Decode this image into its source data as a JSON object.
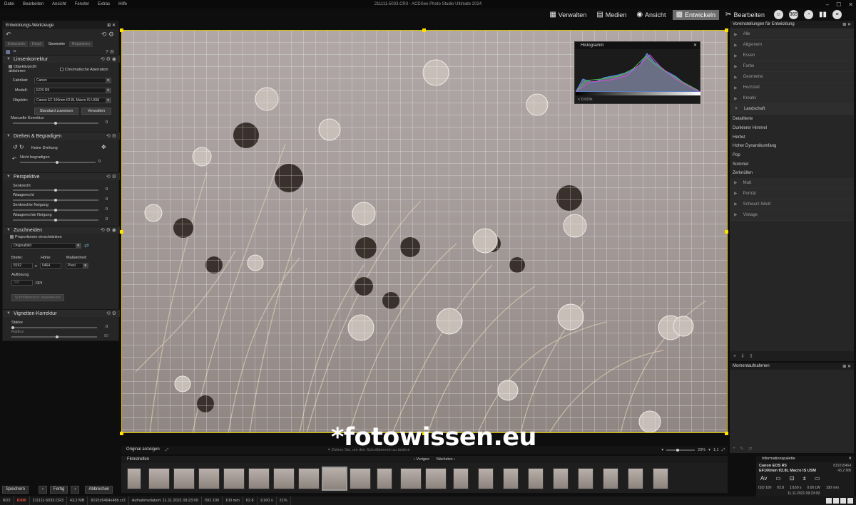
{
  "menubar": {
    "items": [
      "Datei",
      "Bearbeiten",
      "Ansicht",
      "Fenster",
      "Extras",
      "Hilfe"
    ],
    "window_title": "211111-5033.CR3 - ACDSee Photo Studio Ultimate 2024"
  },
  "modes": {
    "verwalten": "Verwalten",
    "medien": "Medien",
    "ansicht": "Ansicht",
    "entwickeln": "Entwickeln",
    "bearbeiten": "Bearbeiten",
    "active": "Entwickeln"
  },
  "left_panel": {
    "title": "Entwicklungs-Werkzeuge",
    "tabs": [
      "Entwickeln",
      "Detail",
      "Geometrie",
      "Reparieren"
    ],
    "active_tab": "Geometrie",
    "lens": {
      "title": "Linsenkorrektur",
      "enable_profile": "Objektivprofil aktivieren",
      "chromatic": "Chromatische Aberration",
      "make_label": "Fabrikat:",
      "make_value": "Canon",
      "model_label": "Modell:",
      "model_value": "EOS R5",
      "lens_label": "Objektiv:",
      "lens_value": "Canon EF 100mm f/2.8L Macro IS USM",
      "default_btn": "Standard zuweisen",
      "manage_btn": "Verwalten",
      "manual_label": "Manuelle Korrektur",
      "manual_value": "0"
    },
    "rotate": {
      "title": "Drehen & Begradigen",
      "rotation": "Keine Drehung",
      "straighten": "Nicht begradigen",
      "straighten_value": "0"
    },
    "perspective": {
      "title": "Perspektive",
      "vertical": "Senkrecht",
      "horizontal": "Waagerecht",
      "vtilt": "Senkrechte Neigung",
      "htilt": "Waagerechte Neigung",
      "v_val": "0",
      "h_val": "0",
      "vt_val": "0",
      "ht_val": "0"
    },
    "crop": {
      "title": "Zuschneiden",
      "constrain": "Proportionen einschränken",
      "ratio": "Originalbild",
      "width_label": "Breite:",
      "height_label": "Höhe:",
      "unit_label": "Maßeinheit:",
      "width": "8192",
      "times": "x",
      "height": "5464",
      "unit": "Pixel",
      "resolution_label": "Auflösung",
      "resolution": "300",
      "dpi": "DPI",
      "maximize_btn": "Schnittbereich maximieren"
    },
    "vignette": {
      "title": "Vignetten-Korrektur",
      "strength": "Stärke",
      "strength_value": "0",
      "radius": "Radius",
      "radius_value": "50"
    }
  },
  "histogram": {
    "title": "Histogramm",
    "stat": "< 0.01%"
  },
  "canvas": {
    "show_original": "Original anzeigen",
    "hint": "Ziehen Sie, um den Schnittbereich zu ändern",
    "zoom": "20%",
    "ratio": "1:1"
  },
  "watermark": "*fotowissen.eu",
  "filmstrip": {
    "title": "Filmstreifen",
    "prev": "Voriges",
    "next": "Nächstes"
  },
  "right_panel": {
    "title": "Voreinstellungen für Entwicklung",
    "categories": [
      "Alle",
      "Allgemein",
      "Essen",
      "Farbe",
      "Geometrie",
      "Hochzeit",
      "Kreativ",
      "Landschaft"
    ],
    "open_category": "Landschaft",
    "presets": [
      "Detaillierte",
      "Dunklerer Himmel",
      "Herbst",
      "Hoher Dynamikumfang",
      "Pop",
      "Sommer",
      "Zerknüllen"
    ],
    "categories_after": [
      "Matt",
      "Porträt",
      "Schwarz-Weiß",
      "Vintage"
    ]
  },
  "snapshots": {
    "title": "Momentaufnahmen"
  },
  "info": {
    "title": "Informationspalette",
    "camera": "Canon EOS R5",
    "lens": "EF100mm f/2.8L Macro IS USM",
    "dims": "8192x5464",
    "size": "43,2 MB",
    "iso": "ISO 100",
    "aperture": "f/2.8",
    "shutter": "1/160 s",
    "ev": "0.00 LW",
    "focal": "100 mm",
    "date": "11.11.2021 09:23:09"
  },
  "bottom_buttons": {
    "save": "Speichern",
    "done": "Fertig",
    "cancel": "Abbrechen"
  },
  "status": {
    "index": "8/22",
    "raw": "RAW",
    "file": "211111-5033.CR3",
    "filesize": "43,2 MB",
    "dims": "8192x5464x48b cr3",
    "date": "Aufnahmedatum: 11.11.2021 09:23:09",
    "iso": "ISO 100",
    "focal": "100 mm",
    "aperture": "f/2.8",
    "shutter": "1/160 s",
    "zoom": "21%"
  }
}
